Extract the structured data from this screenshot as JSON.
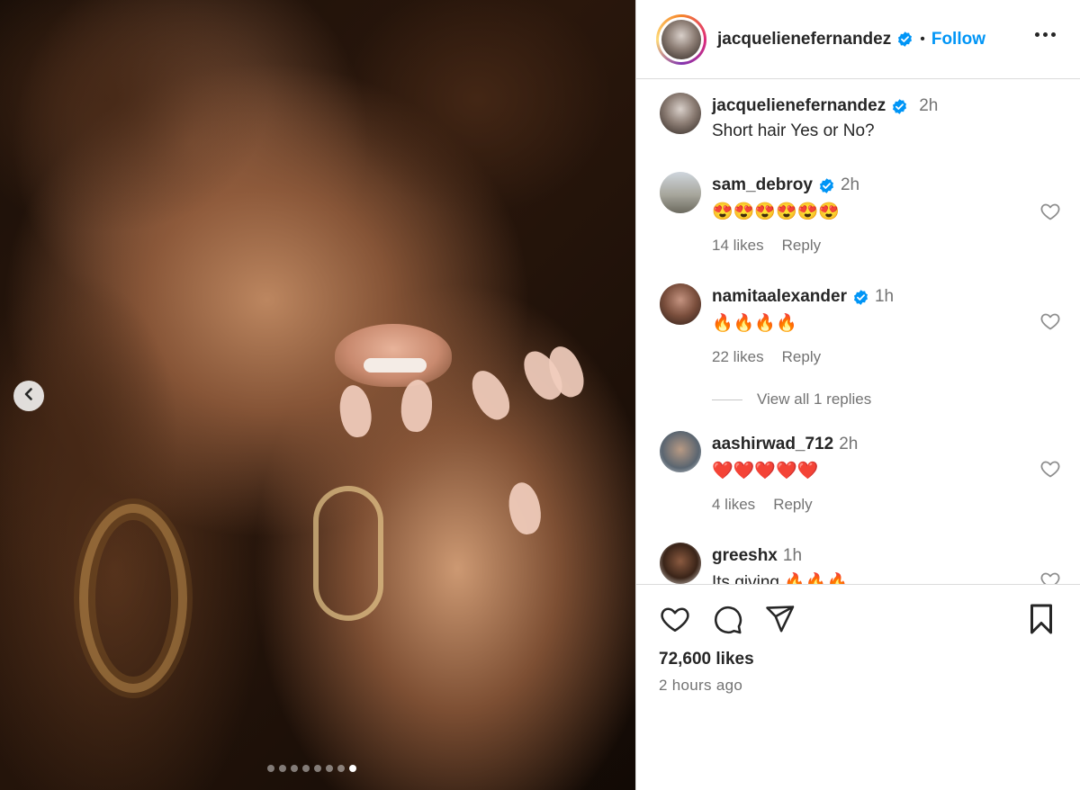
{
  "post": {
    "username": "jacquelienefernandez",
    "verified": true,
    "follow_label": "Follow",
    "separator": "•",
    "caption": "Short hair Yes or No?",
    "caption_time": "2h",
    "likes": "72,600 likes",
    "posted": "2 hours ago"
  },
  "carousel": {
    "slides": 8,
    "active_index": 8
  },
  "comments": [
    {
      "user": "sam_debroy",
      "verified": true,
      "time": "2h",
      "text": "😍😍😍😍😍😍",
      "likes": "14 likes",
      "reply": "Reply"
    },
    {
      "user": "namitaalexander",
      "verified": true,
      "time": "1h",
      "text": "🔥🔥🔥🔥",
      "likes": "22 likes",
      "reply": "Reply"
    },
    {
      "user": "aashirwad_712",
      "verified": false,
      "time": "2h",
      "text": "❤️❤️❤️❤️❤️",
      "likes": "4 likes",
      "reply": "Reply"
    },
    {
      "user": "greeshx",
      "verified": false,
      "time": "1h",
      "text": "Its giving 🔥🔥🔥",
      "likes": "",
      "reply": ""
    }
  ],
  "view_replies": "View all 1 replies",
  "icons": {
    "prev": "chevron-left-icon",
    "more": "more-options-icon",
    "like": "heart-icon",
    "comment": "comment-icon",
    "share": "share-icon",
    "save": "bookmark-icon",
    "verified": "verified-badge-icon"
  },
  "colors": {
    "accent": "#0095f6",
    "text": "#262626",
    "muted": "#737373",
    "border": "#dbdbdb"
  }
}
